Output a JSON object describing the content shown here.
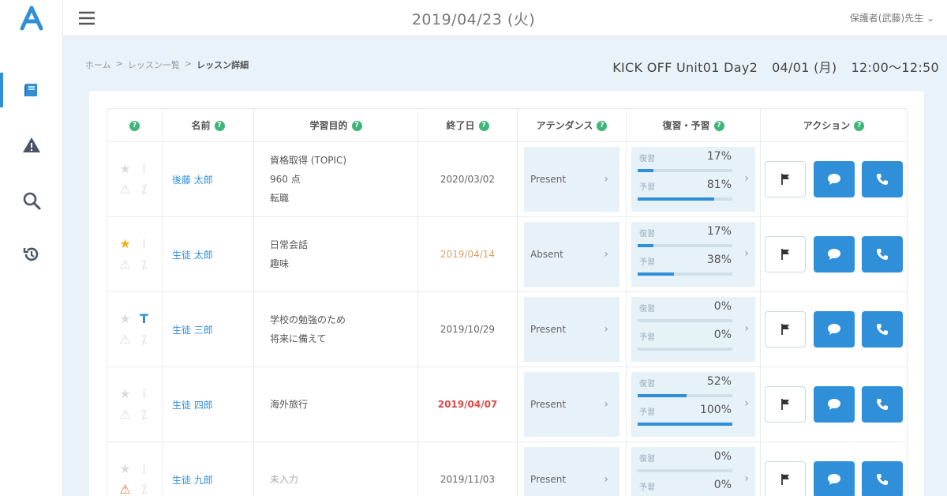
{
  "header": {
    "date": "2019/04/23 (火)",
    "user": "保護者(武藤)先生 ⌄"
  },
  "breadcrumb": [
    "ホーム",
    "レッスン一覧",
    "レッスン詳細"
  ],
  "lesson": {
    "name": "KICK OFF Unit01 Day2",
    "date": "04/01 (月)",
    "time": "12:00～12:50"
  },
  "table": {
    "headers": {
      "name": "名前",
      "goal": "学習目的",
      "deadline": "終了日",
      "attendance": "アテンダンス",
      "review": "復習・予習",
      "action": "アクション"
    },
    "review_labels": {
      "review": "復習",
      "preview": "予習"
    },
    "rows": [
      {
        "name": "後藤 太郎",
        "goal": [
          "資格取得 (TOPIC)",
          "960 点",
          "転職"
        ],
        "deadline": "2020/03/02",
        "deadline_style": "normal",
        "attendance": "Present",
        "review": "17%",
        "preview": "81%",
        "review_fill": 0.17,
        "preview_fill": 0.81,
        "star": false,
        "warn": false,
        "alt": ""
      },
      {
        "name": "生徒 太郎",
        "goal": [
          "日常会話",
          "趣味"
        ],
        "deadline": "2019/04/14",
        "deadline_style": "warn",
        "attendance": "Absent",
        "review": "17%",
        "preview": "38%",
        "review_fill": 0.17,
        "preview_fill": 0.38,
        "star": true,
        "warn": false,
        "alt": ""
      },
      {
        "name": "生徒 三郎",
        "goal": [
          "学校の勉強のため",
          "将来に備えて"
        ],
        "deadline": "2019/10/29",
        "deadline_style": "normal",
        "attendance": "Present",
        "review": "0%",
        "preview": "0%",
        "review_fill": 0,
        "preview_fill": 0,
        "star": false,
        "warn": false,
        "alt": "T"
      },
      {
        "name": "生徒 四郎",
        "goal": [
          "海外旅行"
        ],
        "deadline": "2019/04/07",
        "deadline_style": "late",
        "attendance": "Present",
        "review": "52%",
        "preview": "100%",
        "review_fill": 0.52,
        "preview_fill": 1.0,
        "star": false,
        "warn": false,
        "alt": ""
      },
      {
        "name": "生徒 九郎",
        "goal": [
          "未入力"
        ],
        "deadline": "2019/11/03",
        "deadline_style": "normal",
        "attendance": "Present",
        "review": "0%",
        "preview": "0%",
        "review_fill": 0,
        "preview_fill": 0,
        "star": false,
        "warn": true,
        "alt": ""
      }
    ]
  },
  "colors": {
    "accent": "#2f8fd9",
    "help": "#3eb57a",
    "late": "#d94b4b",
    "warn": "#d9a36a"
  }
}
